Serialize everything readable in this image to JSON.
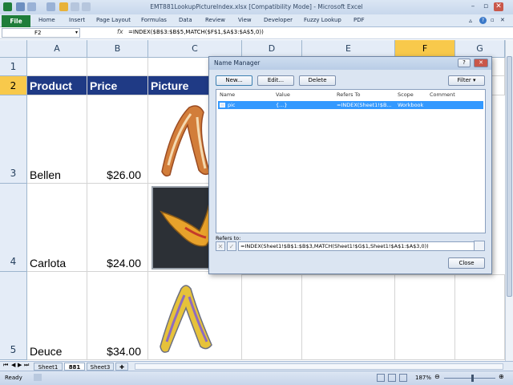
{
  "window": {
    "title": "EMT881LookupPictureIndex.xlsx  [Compatibility Mode]  -  Microsoft Excel"
  },
  "ribbon": {
    "file_label": "File",
    "tabs": [
      "Home",
      "Insert",
      "Page Layout",
      "Formulas",
      "Data",
      "Review",
      "View",
      "Developer",
      "Fuzzy Lookup",
      "PDF"
    ]
  },
  "formula_bar": {
    "name_box": "F2",
    "fx": "fx",
    "formula": "=INDEX($B$3:$B$5,MATCH($F$1,$A$3:$A$5,0))"
  },
  "columns": [
    "A",
    "B",
    "C",
    "D",
    "E",
    "F",
    "G"
  ],
  "rows": [
    "1",
    "2",
    "3",
    "4",
    "5"
  ],
  "sheet": {
    "header": {
      "product": "Product",
      "price": "Price",
      "picture": "Picture"
    },
    "records": [
      {
        "product": "Bellen",
        "price": "$26.00"
      },
      {
        "product": "Carlota",
        "price": "$24.00"
      },
      {
        "product": "Deuce",
        "price": "$34.00"
      }
    ]
  },
  "sheet_tabs": [
    "Sheet1",
    "881",
    "Sheet3"
  ],
  "status": {
    "ready": "Ready",
    "zoom": "187%"
  },
  "name_manager": {
    "title": "Name Manager",
    "new_label": "New...",
    "edit_label": "Edit...",
    "delete_label": "Delete",
    "filter_label": "Filter",
    "columns": {
      "name": "Name",
      "value": "Value",
      "refers_to": "Refers To",
      "scope": "Scope",
      "comment": "Comment"
    },
    "row": {
      "name": "pic",
      "value": "{...}",
      "refers_to": "=INDEX(Sheet1!$B...",
      "scope": "Workbook",
      "comment": ""
    },
    "refers_to_label": "Refers to:",
    "refers_to_value": "=INDEX(Sheet1!$B$1:$B$3,MATCH(Sheet1!$G$1,Sheet1!$A$1:$A$3,0))",
    "close_label": "Close",
    "help": "?"
  },
  "colors": {
    "header_fill": "#1f3a85",
    "selected_header": "#f8c94b",
    "file_tab": "#1f7d3a"
  }
}
